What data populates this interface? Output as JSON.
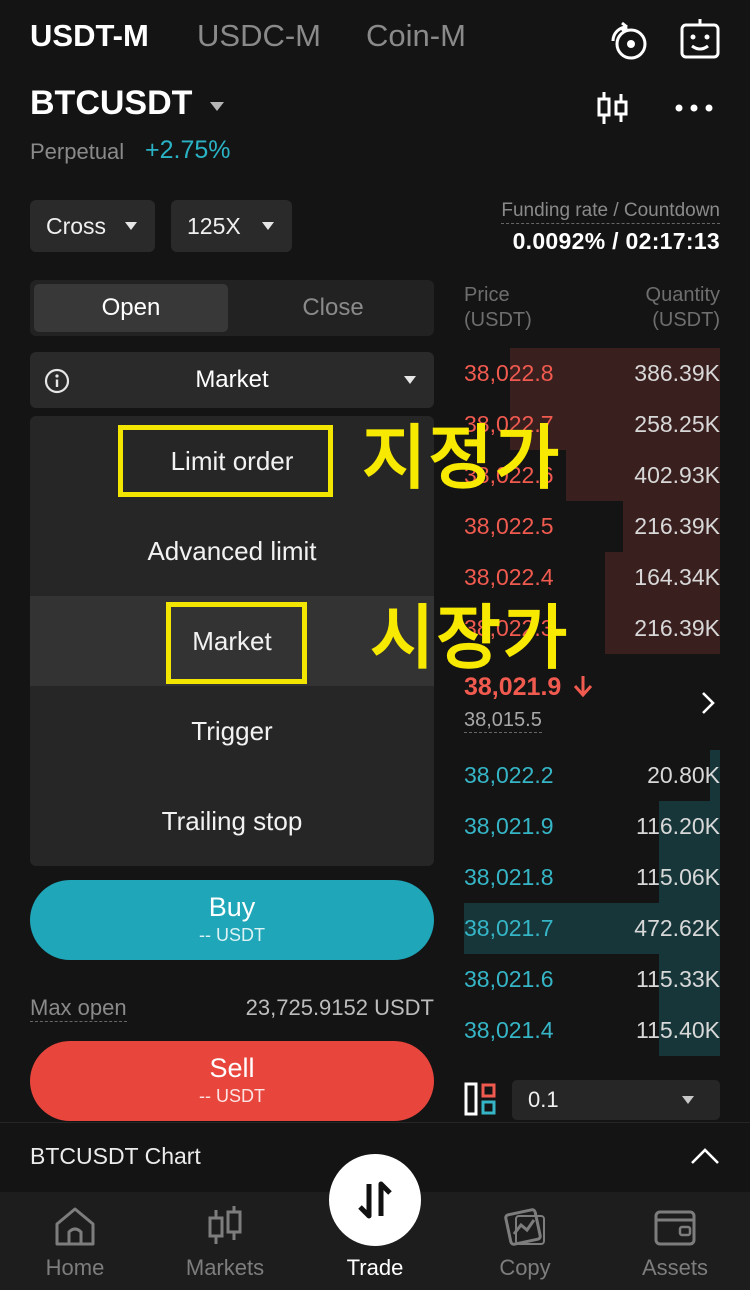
{
  "top_tabs": [
    {
      "label": "USDT-M",
      "active": true
    },
    {
      "label": "USDC-M",
      "active": false
    },
    {
      "label": "Coin-M",
      "active": false
    }
  ],
  "header": {
    "symbol": "BTCUSDT",
    "contract_type": "Perpetual",
    "change": "+2.75%"
  },
  "controls": {
    "margin_mode": "Cross",
    "leverage": "125X",
    "funding_label": "Funding rate / Countdown",
    "funding_value": "0.0092% / 02:17:13"
  },
  "open_close": {
    "open": "Open",
    "close": "Close"
  },
  "order_type": {
    "selected": "Market"
  },
  "order_type_options": [
    "Limit order",
    "Advanced limit",
    "Market",
    "Trigger",
    "Trailing stop"
  ],
  "annotations": {
    "limit_korean": "지정가",
    "market_korean": "시장가",
    "box_color": "#f2e600"
  },
  "buy": {
    "label": "Buy",
    "sub": "-- USDT"
  },
  "sell": {
    "label": "Sell",
    "sub": "-- USDT"
  },
  "max_open": {
    "label": "Max open",
    "value": "23,725.9152 USDT"
  },
  "order_book": {
    "price_header": [
      "Price",
      "(USDT)"
    ],
    "qty_header": [
      "Quantity",
      "(USDT)"
    ],
    "asks": [
      {
        "price": "38,022.8",
        "qty": "386.39K",
        "depth": 0.82
      },
      {
        "price": "38,022.7",
        "qty": "258.25K",
        "depth": 0.82
      },
      {
        "price": "38,022.6",
        "qty": "402.93K",
        "depth": 0.6
      },
      {
        "price": "38,022.5",
        "qty": "216.39K",
        "depth": 0.38
      },
      {
        "price": "38,022.4",
        "qty": "164.34K",
        "depth": 0.45
      },
      {
        "price": "38,022.3",
        "qty": "216.39K",
        "depth": 0.45
      }
    ],
    "last_price": "38,021.9",
    "mark_price": "38,015.5",
    "bids": [
      {
        "price": "38,022.2",
        "qty": "20.80K",
        "depth": 0.04
      },
      {
        "price": "38,021.9",
        "qty": "116.20K",
        "depth": 0.24
      },
      {
        "price": "38,021.8",
        "qty": "115.06K",
        "depth": 0.24
      },
      {
        "price": "38,021.7",
        "qty": "472.62K",
        "depth": 1.0
      },
      {
        "price": "38,021.6",
        "qty": "115.33K",
        "depth": 0.24
      },
      {
        "price": "38,021.4",
        "qty": "115.40K",
        "depth": 0.24
      }
    ],
    "precision": "0.1"
  },
  "chart_bar": {
    "label": "BTCUSDT  Chart"
  },
  "nav": [
    {
      "label": "Home",
      "icon": "home-icon"
    },
    {
      "label": "Markets",
      "icon": "markets-icon"
    },
    {
      "label": "Trade",
      "icon": "trade-icon"
    },
    {
      "label": "Copy",
      "icon": "copy-icon"
    },
    {
      "label": "Assets",
      "icon": "wallet-icon"
    }
  ],
  "colors": {
    "ask": "#f05a4f",
    "bid": "#35b5c6",
    "buy": "#1fa6b8",
    "sell": "#e8453c",
    "highlight": "#f7ea00"
  }
}
